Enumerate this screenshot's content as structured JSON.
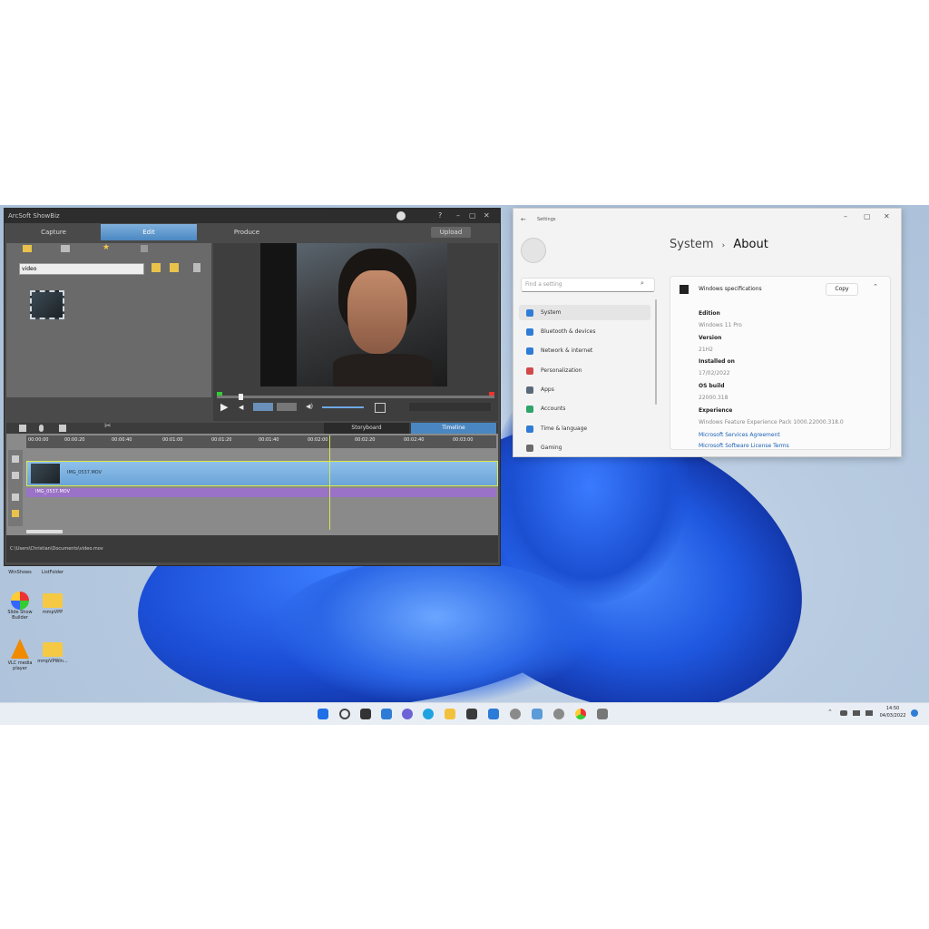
{
  "editor": {
    "title": "ArcSoft ShowBiz",
    "tabs": [
      "Capture",
      "Edit",
      "Produce"
    ],
    "publish_label": "Upload",
    "search_value": "video",
    "timeline_modes": [
      "Storyboard",
      "Timeline"
    ],
    "ruler": [
      "00:00:00",
      "00:00:20",
      "00:00:40",
      "00:01:00",
      "00:01:20",
      "00:01:40",
      "00:02:00",
      "00:02:20",
      "00:02:40",
      "00:03:00"
    ],
    "video_track_label": "IMG_0537.MOV",
    "audio_track_label": "IMG_0537.MOV",
    "status_path": "C:\\Users\\Christian\\Documents\\video.mov"
  },
  "settings": {
    "window_title": "Settings",
    "breadcrumb_parent": "System",
    "breadcrumb_current": "About",
    "search_placeholder": "Find a setting",
    "nav": [
      {
        "label": "System",
        "color": "#2f7cd6"
      },
      {
        "label": "Bluetooth & devices",
        "color": "#2f7cd6"
      },
      {
        "label": "Network & internet",
        "color": "#2f7cd6"
      },
      {
        "label": "Personalization",
        "color": "#d04a4a"
      },
      {
        "label": "Apps",
        "color": "#5a6a7a"
      },
      {
        "label": "Accounts",
        "color": "#2ea36a"
      },
      {
        "label": "Time & language",
        "color": "#2f7cd6"
      },
      {
        "label": "Gaming",
        "color": "#6a6a6a"
      }
    ],
    "spec_header": "Windows specifications",
    "copy_label": "Copy",
    "specs": [
      {
        "label": "Edition",
        "value": "Windows 11 Pro"
      },
      {
        "label": "Version",
        "value": "21H2"
      },
      {
        "label": "Installed on",
        "value": "17/02/2022"
      },
      {
        "label": "OS build",
        "value": "22000.318"
      },
      {
        "label": "Experience",
        "value": "Windows Feature Experience Pack 1000.22000.318.0"
      }
    ],
    "links": [
      "Microsoft Services Agreement",
      "Microsoft Software License Terms"
    ]
  },
  "desktop": {
    "icons": [
      {
        "label": "WinShows"
      },
      {
        "label": "ListFolder"
      },
      {
        "label": "Slide Show Builder"
      },
      {
        "label": "mmpVPP"
      },
      {
        "label": "VLC media player"
      },
      {
        "label": "mmpVPWin..."
      }
    ]
  },
  "taskbar": {
    "clock_time": "14:50",
    "clock_date": "04/03/2022"
  }
}
